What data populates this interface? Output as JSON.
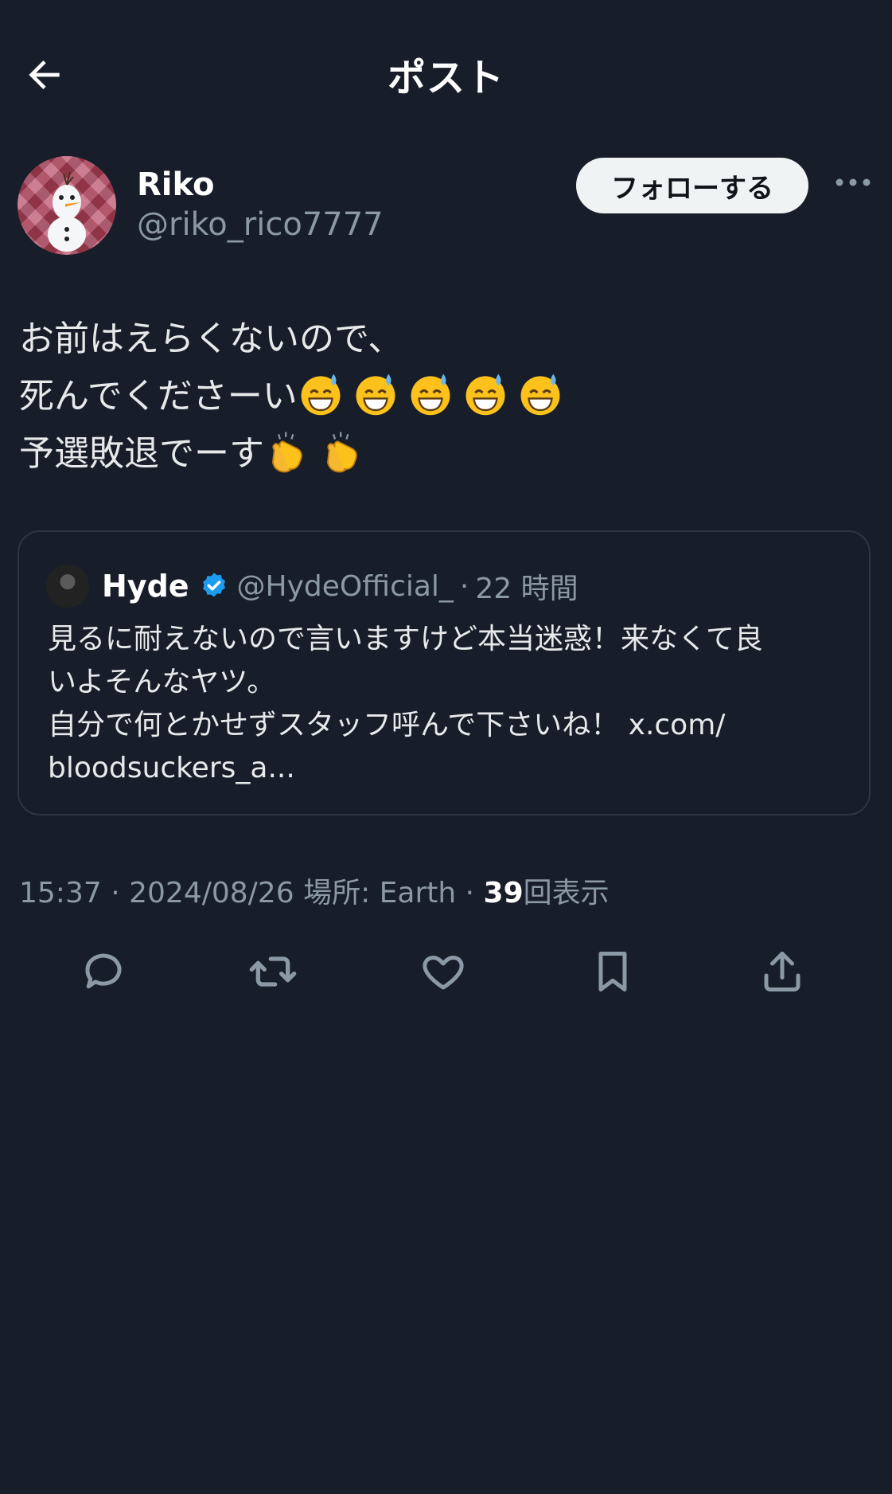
{
  "header": {
    "title": "ポスト"
  },
  "author": {
    "name": "Riko",
    "handle": "@riko_rico7777"
  },
  "follow_label": "フォローする",
  "post": {
    "line1": "お前はえらくないので、",
    "line2": "死んでくださーい",
    "line3": "予選敗退でーす",
    "emoji_line2": [
      "grinning-sweat-emoji",
      "grinning-sweat-emoji",
      "grinning-sweat-emoji",
      "grinning-sweat-emoji",
      "grinning-sweat-emoji"
    ],
    "emoji_line3": [
      "clapping-hands-emoji",
      "clapping-hands-emoji"
    ]
  },
  "quote": {
    "name": "Hyde",
    "handle": "@HydeOfficial_",
    "separator": "·",
    "time": "22 時間",
    "line1": "見るに耐えないので言いますけど本当迷惑！来なくて良",
    "line2": "いよそんなヤツ。",
    "line3": "自分で何とかせずスタッフ呼んで下さいね！ x.com/",
    "line4": "bloodsuckers_a..."
  },
  "meta": {
    "time": "15:37",
    "sep1": "·",
    "date": "2024/08/26",
    "location": "場所: Earth",
    "sep2": "·",
    "views_count": "39",
    "views_label": "回表示"
  },
  "colors": {
    "background": "#171d29",
    "text": "#e7e9ea",
    "muted": "#8b98a5",
    "verified": "#1d9bf0"
  },
  "icons": [
    "back-arrow-icon",
    "more-icon",
    "verified-badge-icon",
    "reply-icon",
    "retweet-icon",
    "like-icon",
    "bookmark-icon",
    "share-icon"
  ]
}
